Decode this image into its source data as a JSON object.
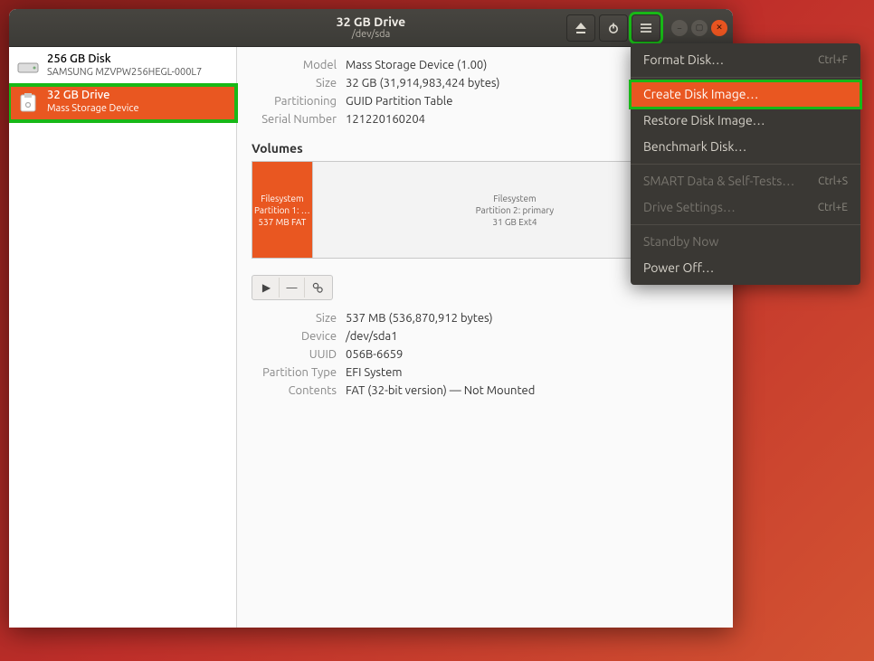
{
  "titlebar": {
    "title": "32 GB Drive",
    "subtitle": "/dev/sda"
  },
  "sidebar": {
    "disks": [
      {
        "title": "256 GB Disk",
        "sub": "SAMSUNG MZVPW256HEGL-000L7",
        "selected": false
      },
      {
        "title": "32 GB Drive",
        "sub": "Mass Storage Device",
        "selected": true
      }
    ]
  },
  "info": {
    "model_label": "Model",
    "model": "Mass Storage Device (1.00)",
    "size_label": "Size",
    "size": "32 GB (31,914,983,424 bytes)",
    "partitioning_label": "Partitioning",
    "partitioning": "GUID Partition Table",
    "serial_label": "Serial Number",
    "serial": "121220160204"
  },
  "volumes_header": "Volumes",
  "volumes": [
    {
      "l1": "Filesystem",
      "l2": "Partition 1: …",
      "l3": "537 MB FAT",
      "selected": true,
      "width": "13%"
    },
    {
      "l1": "Filesystem",
      "l2": "Partition 2: primary",
      "l3": "31 GB Ext4",
      "selected": false,
      "width": "87%"
    }
  ],
  "voldetails": {
    "size_label": "Size",
    "size": "537 MB (536,870,912 bytes)",
    "device_label": "Device",
    "device": "/dev/sda1",
    "uuid_label": "UUID",
    "uuid": "056B-6659",
    "ptype_label": "Partition Type",
    "ptype": "EFI System",
    "contents_label": "Contents",
    "contents": "FAT (32-bit version) — Not Mounted"
  },
  "menu": {
    "format": {
      "label": "Format Disk…",
      "accel": "Ctrl+F"
    },
    "create": {
      "label": "Create Disk Image…"
    },
    "restore": {
      "label": "Restore Disk Image…"
    },
    "bench": {
      "label": "Benchmark Disk…"
    },
    "smart": {
      "label": "SMART Data & Self-Tests…",
      "accel": "Ctrl+S"
    },
    "settings": {
      "label": "Drive Settings…",
      "accel": "Ctrl+E"
    },
    "standby": {
      "label": "Standby Now"
    },
    "poweroff": {
      "label": "Power Off…"
    }
  }
}
